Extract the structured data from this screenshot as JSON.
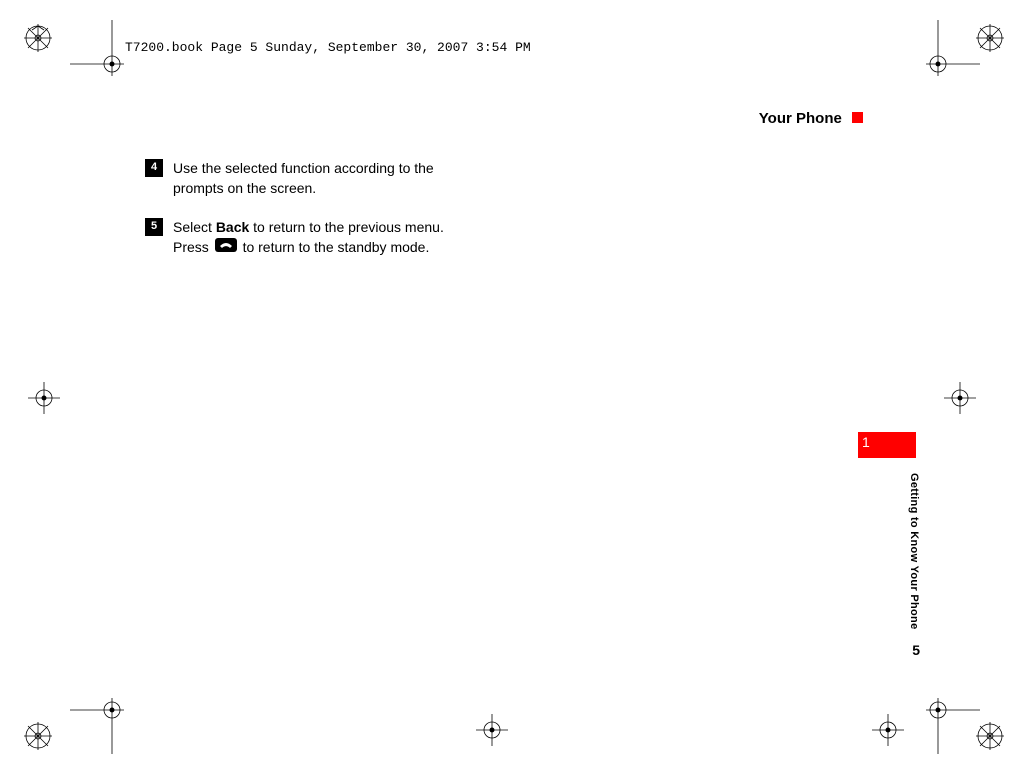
{
  "framemaker_header": "T7200.book  Page 5  Sunday, September 30, 2007  3:54 PM",
  "running_header": "Your Phone",
  "steps": {
    "s4": {
      "num": "4",
      "text": "Use the selected function according to the prompts on the screen."
    },
    "s5": {
      "num": "5",
      "text_pre": "Select ",
      "bold1": "Back",
      "text_mid": " to return to the previous menu. Press ",
      "text_post": " to return to the standby mode."
    }
  },
  "side_tab_number": "1",
  "section_label": "Getting to Know Your Phone",
  "page_number": "5"
}
